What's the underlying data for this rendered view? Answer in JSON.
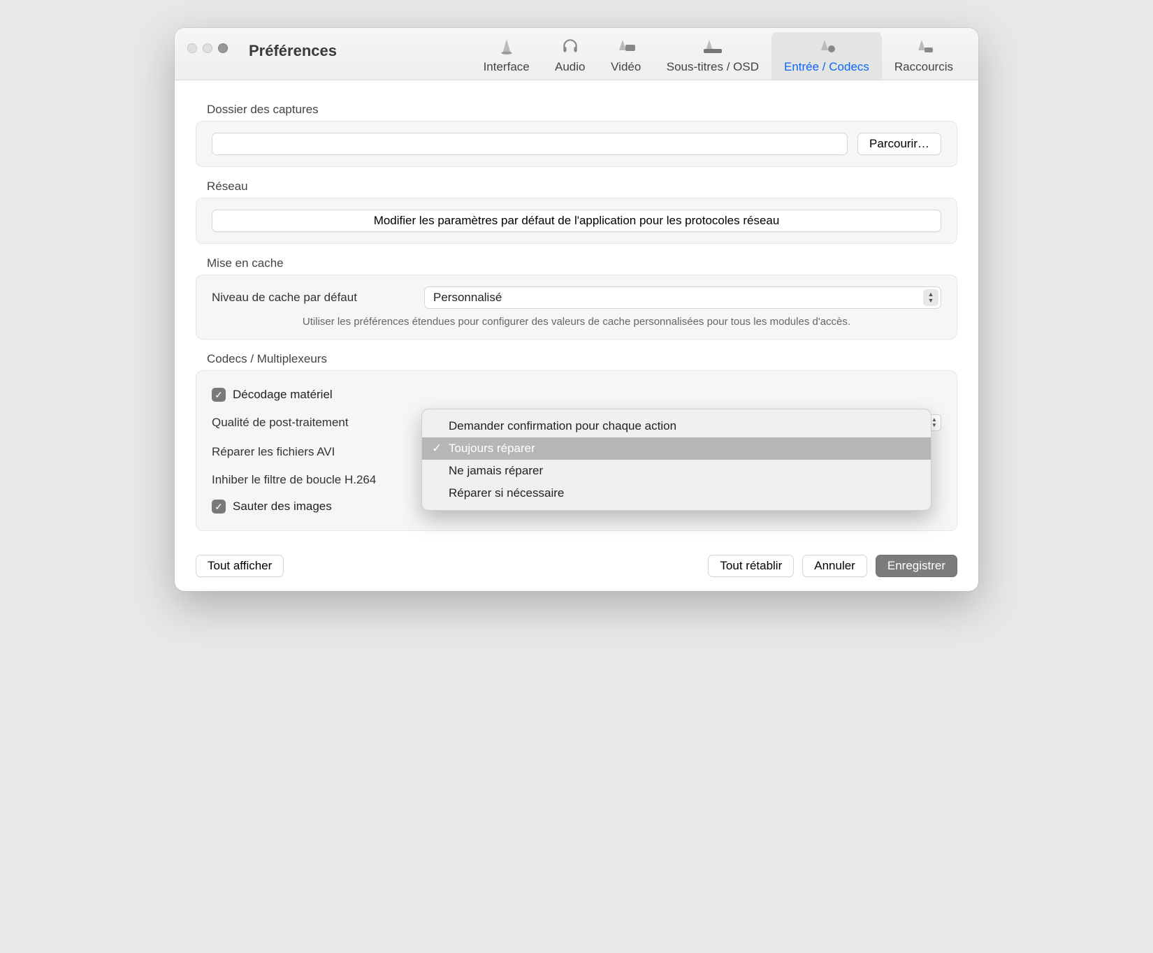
{
  "window": {
    "title": "Préférences"
  },
  "tabs": [
    {
      "label": "Interface"
    },
    {
      "label": "Audio"
    },
    {
      "label": "Vidéo"
    },
    {
      "label": "Sous-titres / OSD"
    },
    {
      "label": "Entrée / Codecs",
      "active": true
    },
    {
      "label": "Raccourcis"
    }
  ],
  "sections": {
    "captures": {
      "title": "Dossier des captures",
      "value": "",
      "browse": "Parcourir…"
    },
    "network": {
      "title": "Réseau",
      "button": "Modifier les paramètres par défaut de l'application pour les protocoles réseau"
    },
    "cache": {
      "title": "Mise en cache",
      "row_label": "Niveau de cache par défaut",
      "value": "Personnalisé",
      "hint": "Utiliser les préférences étendues pour configurer des valeurs de cache personnalisées pour tous les modules d'accès."
    },
    "codecs": {
      "title": "Codecs / Multiplexeurs",
      "hw_decode": "Décodage matériel",
      "post_quality": "Qualité de post-traitement",
      "repair_avi": "Réparer les fichiers AVI",
      "loop_filter": "Inhiber le filtre de boucle H.264",
      "skip_frames": "Sauter des images",
      "hw_decode_checked": true,
      "skip_frames_checked": true
    }
  },
  "dropdown": {
    "items": [
      "Demander confirmation pour chaque action",
      "Toujours réparer",
      "Ne jamais réparer",
      "Réparer si nécessaire"
    ],
    "selected_index": 1
  },
  "footer": {
    "show_all": "Tout afficher",
    "reset_all": "Tout rétablir",
    "cancel": "Annuler",
    "save": "Enregistrer"
  }
}
